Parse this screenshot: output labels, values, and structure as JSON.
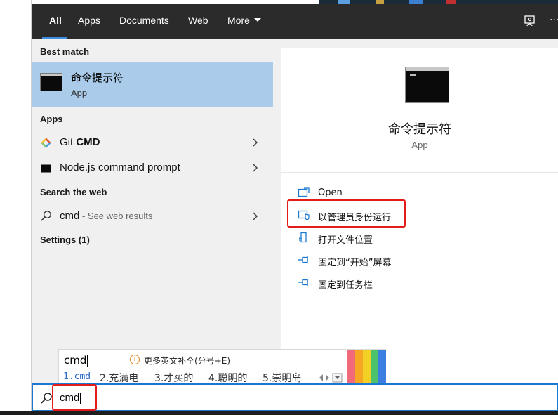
{
  "tabs": [
    {
      "label": "All",
      "active": true
    },
    {
      "label": "Apps"
    },
    {
      "label": "Documents"
    },
    {
      "label": "Web"
    },
    {
      "label": "More"
    }
  ],
  "header_icons": [
    "feedback-icon",
    "more-options-icon"
  ],
  "left": {
    "best_match_heading": "Best match",
    "best_match": {
      "title": "命令提示符",
      "subtitle": "App",
      "icon": "command-prompt-icon"
    },
    "apps_heading": "Apps",
    "apps": [
      {
        "label_prefix": "Git ",
        "label_bold": "CMD",
        "icon": "git-icon"
      },
      {
        "label": "Node.js command prompt",
        "icon": "terminal-icon"
      }
    ],
    "web_heading": "Search the web",
    "web_result": {
      "query": "cmd",
      "suffix": " - See web results"
    },
    "settings_label": "Settings (1)"
  },
  "details": {
    "title": "命令提示符",
    "subtitle": "App",
    "actions": [
      {
        "label": "Open",
        "icon": "open-icon"
      },
      {
        "label": "以管理员身份运行",
        "icon": "run-as-admin-icon"
      },
      {
        "label": "打开文件位置",
        "icon": "file-location-icon"
      },
      {
        "label": "固定到“开始”屏幕",
        "icon": "pin-start-icon"
      },
      {
        "label": "固定到任务栏",
        "icon": "pin-taskbar-icon"
      }
    ]
  },
  "ime": {
    "input": "cmd",
    "hint": "更多英文补全(分号+E)",
    "candidates": [
      "1.cmd",
      "2.充满电",
      "3.才买的",
      "4.聪明的",
      "5.崇明岛"
    ],
    "skin_colors": [
      "#f06a7a",
      "#f5a623",
      "#f2d024",
      "#4cc26a",
      "#3d7fe0"
    ]
  },
  "search": {
    "value": "cmd"
  },
  "colors": {
    "accent": "#1b78d0",
    "highlight": "#aacbea",
    "header": "#2b2b2b",
    "annotation": "#e31b1b"
  }
}
